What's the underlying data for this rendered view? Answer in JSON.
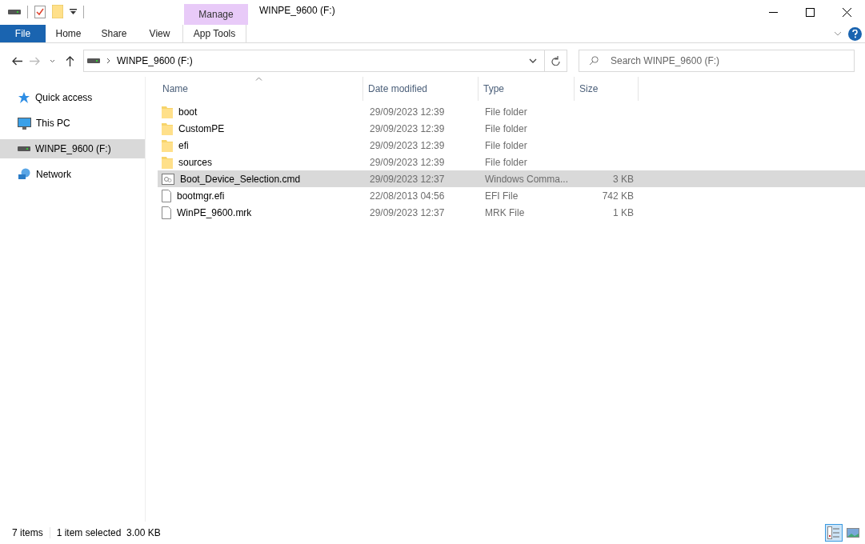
{
  "window": {
    "title": "WINPE_9600 (F:)",
    "context_tab_group": "Manage"
  },
  "ribbon": {
    "tabs": [
      {
        "label": "File",
        "kind": "file"
      },
      {
        "label": "Home",
        "kind": "tab"
      },
      {
        "label": "Share",
        "kind": "tab"
      },
      {
        "label": "View",
        "kind": "tab"
      },
      {
        "label": "App Tools",
        "kind": "context"
      }
    ]
  },
  "address_bar": {
    "path": "WINPE_9600 (F:)"
  },
  "search": {
    "placeholder": "Search WINPE_9600 (F:)"
  },
  "sidebar": {
    "items": [
      {
        "label": "Quick access",
        "kind": "star",
        "selected": false
      },
      {
        "label": "This PC",
        "kind": "pc",
        "selected": false
      },
      {
        "label": "WINPE_9600 (F:)",
        "kind": "drive",
        "selected": true
      },
      {
        "label": "Network",
        "kind": "network",
        "selected": false
      }
    ]
  },
  "table": {
    "columns": [
      "Name",
      "Date modified",
      "Type",
      "Size"
    ],
    "rows": [
      {
        "kind": "folder",
        "name": "boot",
        "date": "29/09/2023 12:39",
        "type": "File folder",
        "selected": false
      },
      {
        "kind": "folder",
        "name": "CustomPE",
        "date": "29/09/2023 12:39",
        "type": "File folder",
        "selected": false
      },
      {
        "kind": "folder",
        "name": "efi",
        "date": "29/09/2023 12:39",
        "type": "File folder",
        "selected": false
      },
      {
        "kind": "folder",
        "name": "sources",
        "date": "29/09/2023 12:39",
        "type": "File folder",
        "selected": false
      },
      {
        "kind": "script",
        "name": "Boot_Device_Selection.cmd",
        "date": "29/09/2023 12:37",
        "type": "Windows Comma...",
        "size": "3 KB",
        "selected": true
      },
      {
        "kind": "file",
        "name": "bootmgr.efi",
        "date": "22/08/2013 04:56",
        "type": "EFI File",
        "size": "742 KB",
        "selected": false
      },
      {
        "kind": "file",
        "name": "WinPE_9600.mrk",
        "date": "29/09/2023 12:37",
        "type": "MRK File",
        "size": "1 KB",
        "selected": false
      }
    ]
  },
  "status_bar": {
    "count": "7 items",
    "selection": "1 item selected  3.00 KB"
  }
}
